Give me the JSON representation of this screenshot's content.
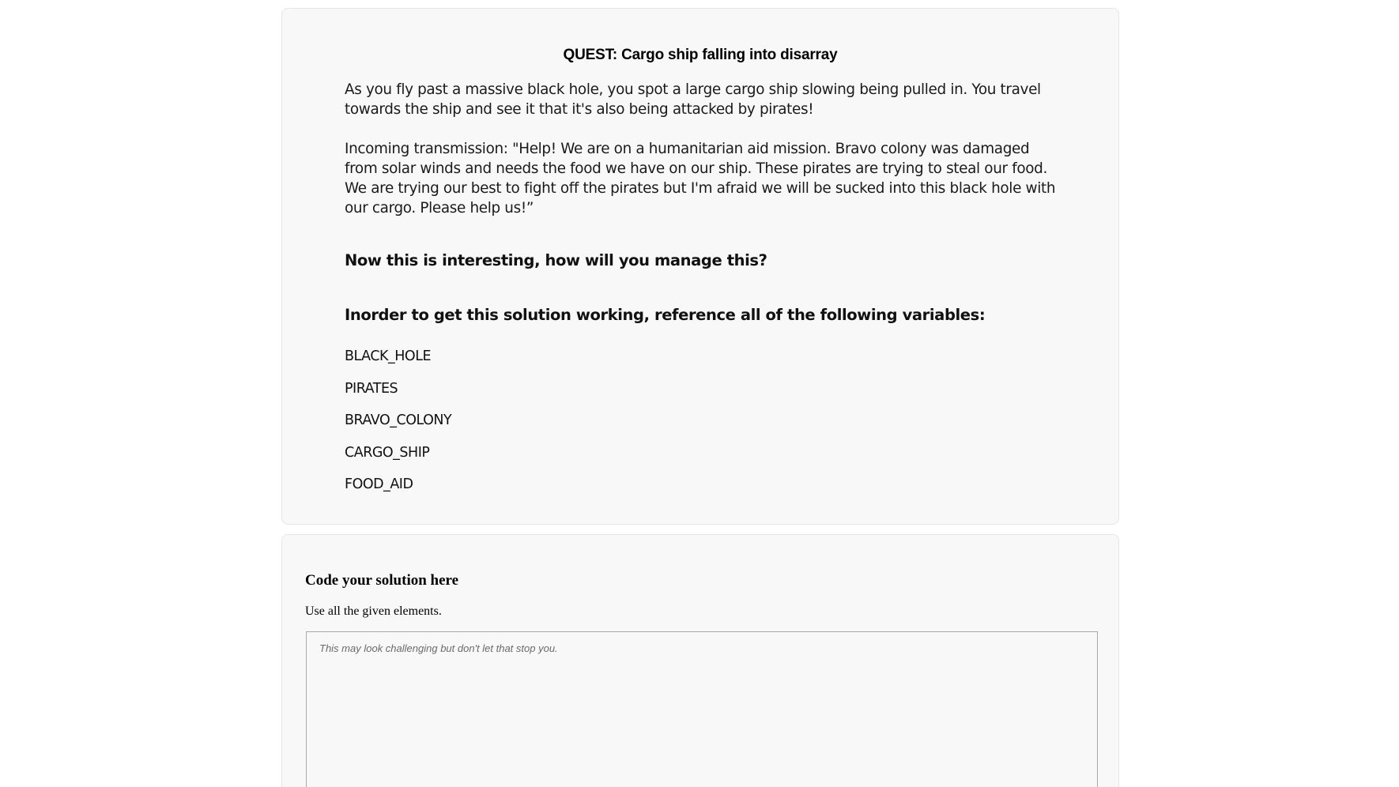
{
  "quest": {
    "title": "QUEST: Cargo ship falling into disarray",
    "paragraphs": [
      "As you fly past a massive black hole, you spot a large cargo ship slowing being pulled in. You travel towards the ship and see it that it's also being attacked by pirates!",
      "Incoming transmission: \"Help! We are on a humanitarian aid mission. Bravo colony was damaged from solar winds and needs the food we have on our ship. These pirates are trying to steal our food. We are trying our best to fight off the pirates but I'm afraid we will be sucked into this black hole with our cargo. Please help us!”"
    ],
    "prompt_manage": "Now this is interesting, how will you manage this?",
    "prompt_variables": "Inorder to get this solution working, reference all of the following variables:",
    "variables": [
      "BLACK_HOLE",
      "PIRATES",
      "BRAVO_COLONY",
      "CARGO_SHIP",
      "FOOD_AID"
    ]
  },
  "solution": {
    "heading": "Code your solution here",
    "instruction": "Use all the given elements.",
    "placeholder": "This may look challenging but don't let that stop you.",
    "value": ""
  }
}
